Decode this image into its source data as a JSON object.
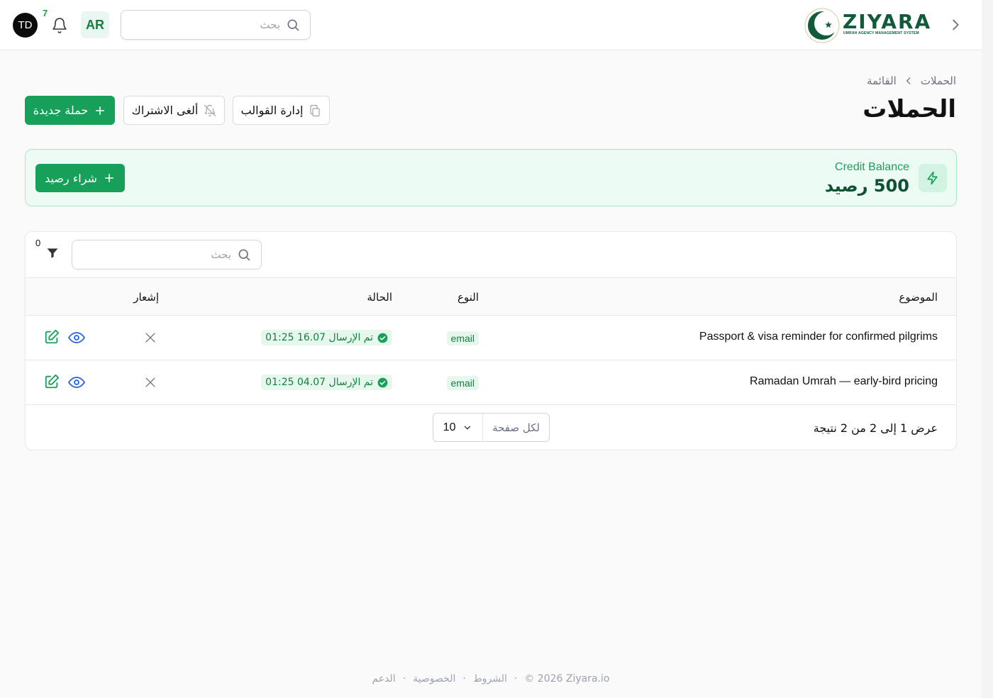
{
  "header": {
    "avatar_initials": "TD",
    "notification_count": "7",
    "language_label": "AR",
    "search_placeholder": "بحث",
    "logo_text": "ZIYARA",
    "logo_subtitle": "UMRAH AGENCY MANAGEMENT SYSTEM"
  },
  "breadcrumb": {
    "items": [
      "الحملات",
      "القائمة"
    ]
  },
  "page_title": "الحملات",
  "actions": {
    "manage_templates": "إدارة القوالب",
    "unsubscribe": "ألغى الاشتراك",
    "new_campaign": "حملة جديدة"
  },
  "credit": {
    "label": "Credit Balance",
    "value": "500 رصيد",
    "buy_label": "شراء رصيد"
  },
  "table": {
    "filter_count": "0",
    "search_placeholder": "بحث",
    "headers": {
      "subject": "الموضوع",
      "type": "النوع",
      "status": "الحالة",
      "notification": "إشعار"
    },
    "rows": [
      {
        "subject": "Passport & visa reminder for confirmed pilgrims",
        "type": "email",
        "status": "تم الإرسال 16.07 01:25"
      },
      {
        "subject": "Ramadan Umrah — early-bird pricing",
        "type": "email",
        "status": "تم الإرسال 04.07 01:25"
      }
    ],
    "results_text": "عرض 1 إلى 2 من 2 نتيجة",
    "per_page_label": "لكل صفحة",
    "per_page_value": "10"
  },
  "footer": {
    "copyright": "© 2026 Ziyara.io",
    "terms": "الشروط",
    "privacy": "الخصوصية",
    "support": "الدعم",
    "separator": "·"
  },
  "colors": {
    "accent": "#16a05a",
    "brand": "#0f5b3a",
    "credit_bg": "#ecfbf3"
  }
}
